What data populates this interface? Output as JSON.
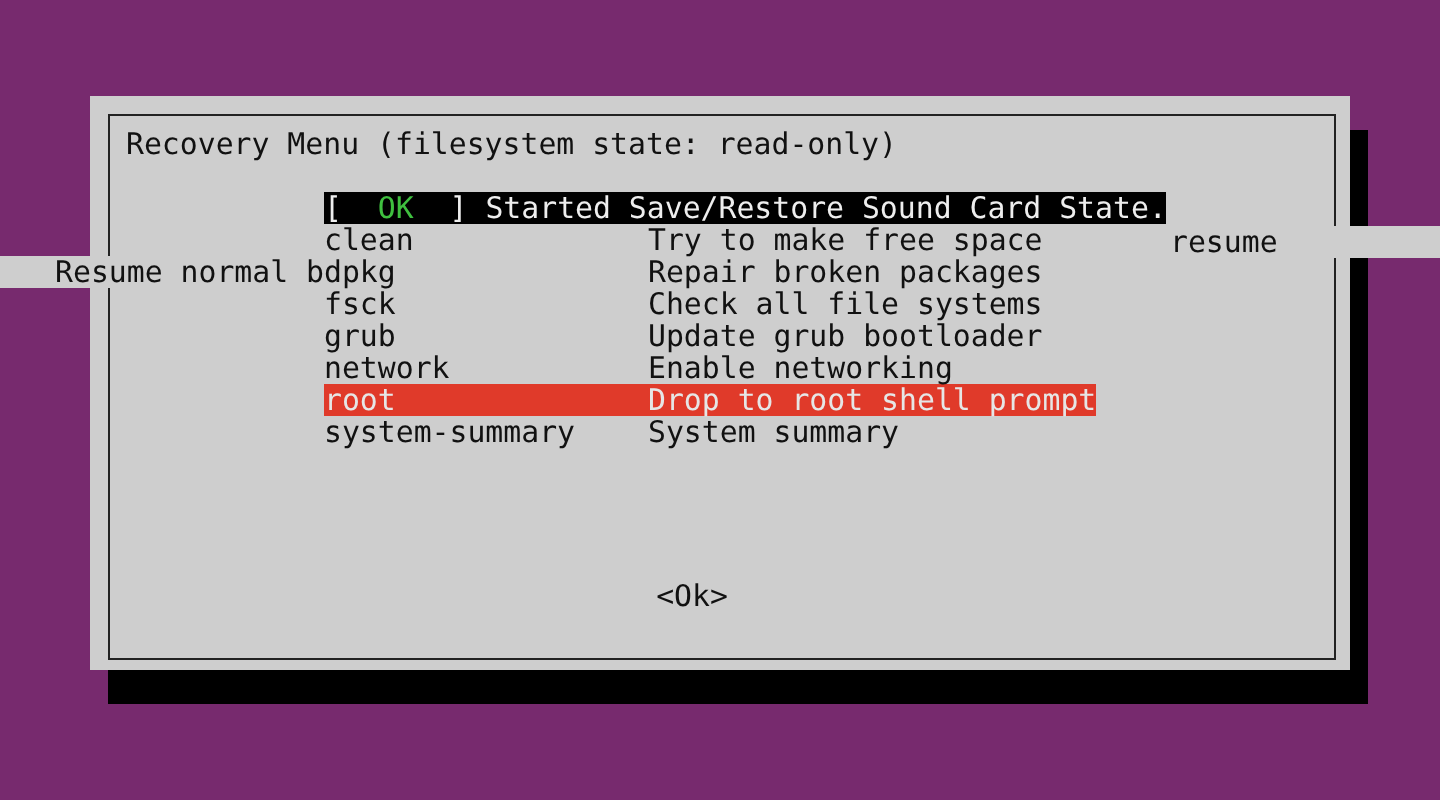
{
  "dialog": {
    "title": "Recovery Menu (filesystem state: read-only)"
  },
  "boot_message": {
    "open": "[",
    "status": "OK",
    "close": "]",
    "message": "Started Save/Restore Sound Card State."
  },
  "items": [
    {
      "name": "clean",
      "description": "Try to make free space",
      "selected": false
    },
    {
      "name": "dpkg",
      "description": "Repair broken packages",
      "selected": false
    },
    {
      "name": "fsck",
      "description": "Check all file systems",
      "selected": false
    },
    {
      "name": "grub",
      "description": "Update grub bootloader",
      "selected": false
    },
    {
      "name": "network",
      "description": "Enable networking",
      "selected": false
    },
    {
      "name": "root",
      "description": "Drop to root shell prompt",
      "selected": true
    },
    {
      "name": "system-summary",
      "description": "System summary",
      "selected": false
    }
  ],
  "glitch_fragments": [
    {
      "kind": "right",
      "text": "resume"
    },
    {
      "kind": "left",
      "text": "Resume normal b"
    }
  ],
  "button": {
    "label": "<Ok>"
  }
}
